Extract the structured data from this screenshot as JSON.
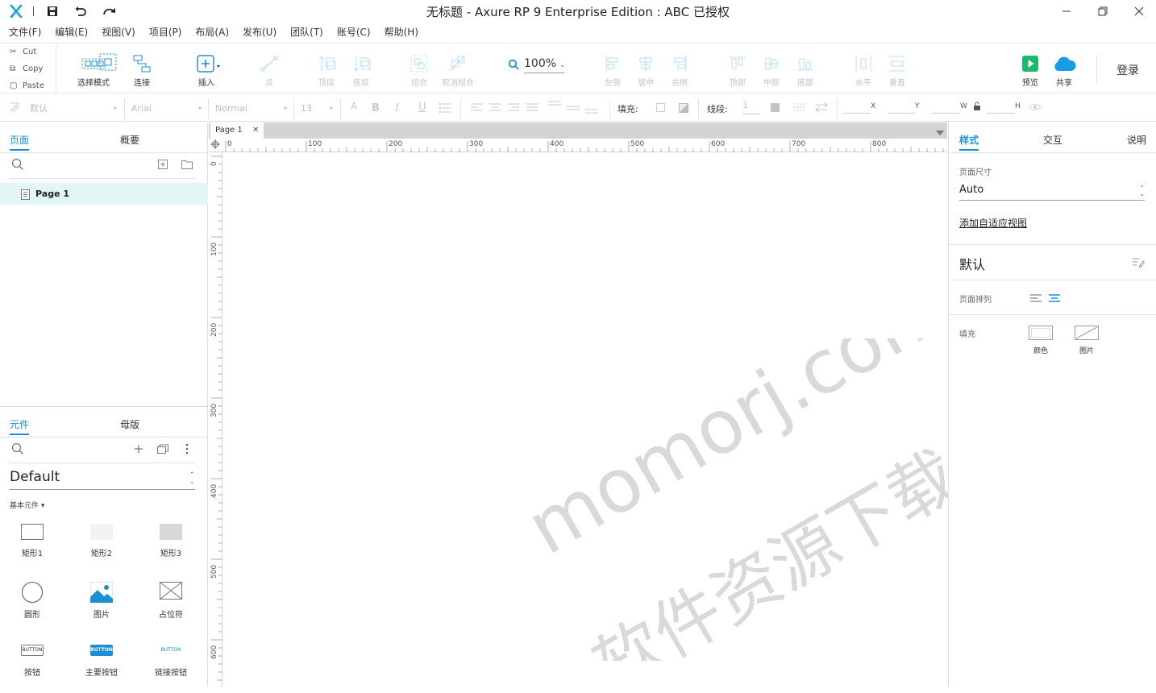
{
  "titlebar": {
    "title": "无标题 - Axure RP 9 Enterprise Edition : ABC 已授权",
    "app_icon": "axure-logo",
    "icons": [
      "save-icon",
      "undo-icon",
      "redo-icon"
    ]
  },
  "menu": [
    "文件(F)",
    "编辑(E)",
    "视图(V)",
    "项目(P)",
    "布局(A)",
    "发布(U)",
    "团队(T)",
    "账号(C)",
    "帮助(H)"
  ],
  "clipboard": {
    "cut": "Cut",
    "copy": "Copy",
    "paste": "Paste"
  },
  "toolbar": {
    "select_mode": "选择模式",
    "connect": "连接",
    "insert": "插入",
    "point": "点",
    "top_layer": "顶层",
    "bottom_layer": "底层",
    "group": "组合",
    "ungroup": "取消组合",
    "zoom": "100%",
    "align_left": "左侧",
    "align_center": "居中",
    "align_right": "右侧",
    "align_top": "顶部",
    "align_middle": "中部",
    "align_bottom": "底部",
    "dist_horizontal": "水平",
    "dist_vertical": "垂直",
    "preview": "预览",
    "share": "共享",
    "login": "登录"
  },
  "format": {
    "style": "默认",
    "font": "Arial",
    "weight": "Normal",
    "size": "13",
    "fill_label": "填充:",
    "line_label": "线段:",
    "line_width": "1",
    "x_label": "X",
    "y_label": "Y",
    "w_label": "W",
    "h_label": "H"
  },
  "pages_panel": {
    "tab_pages": "页面",
    "tab_outline": "概要",
    "pages": [
      "Page 1"
    ]
  },
  "library_panel": {
    "tab_widgets": "元件",
    "tab_masters": "母版",
    "library": "Default",
    "section": "基本元件 ▾",
    "widgets": [
      "矩形1",
      "矩形2",
      "矩形3",
      "圆形",
      "图片",
      "占位符",
      "按钮",
      "主要按钮",
      "链接按钮"
    ],
    "button_text": "BUTTON"
  },
  "canvas": {
    "tab": "Page 1",
    "hruler_labels": [
      "0",
      "100",
      "200",
      "300",
      "400",
      "500",
      "600",
      "700",
      "800"
    ],
    "vruler_labels": [
      "0",
      "100",
      "200",
      "300",
      "400",
      "500",
      "600"
    ],
    "watermark_line1": "momorj.com",
    "watermark_line2": "软件资源下载"
  },
  "right_panel": {
    "tab_style": "样式",
    "tab_interact": "交互",
    "tab_notes": "说明",
    "page_size_label": "页面尺寸",
    "page_size_value": "Auto",
    "adaptive_link": "添加自适应视图",
    "style_name": "默认",
    "page_align_label": "页面排列",
    "fill_label": "填充",
    "fill_color": "颜色",
    "fill_image": "图片"
  },
  "colors": {
    "accent": "#1a8fd6",
    "preview_green": "#1bb96e",
    "share_blue": "#1a9be6",
    "disabled": "#c4c4c4"
  }
}
